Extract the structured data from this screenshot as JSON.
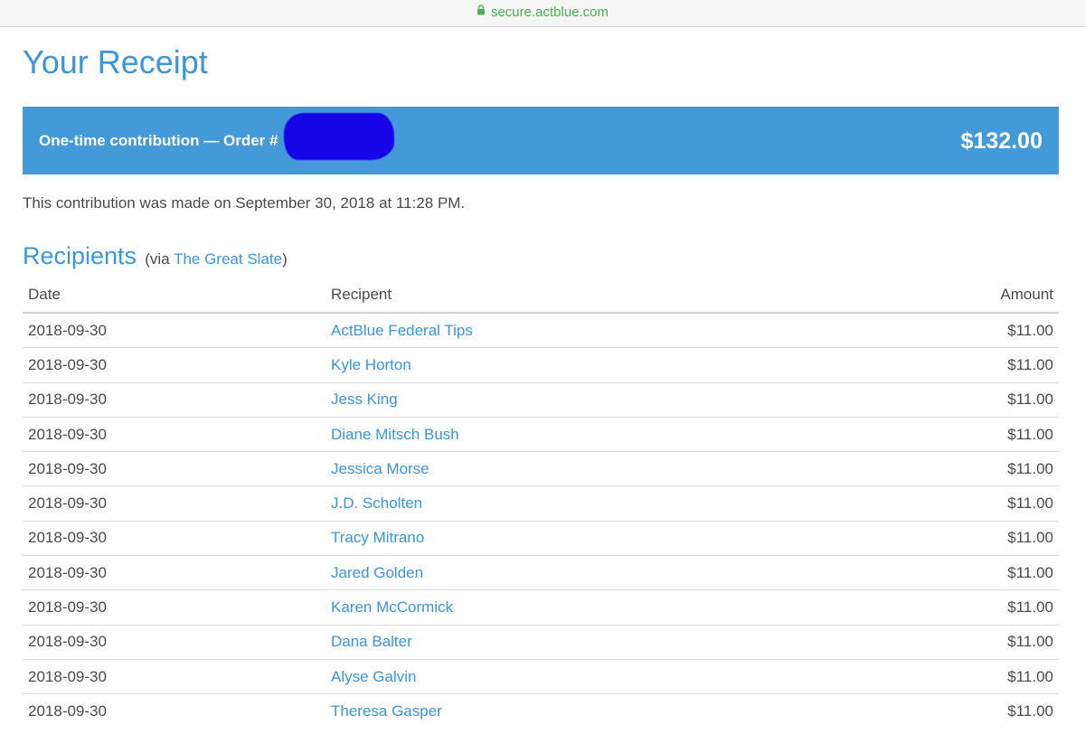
{
  "browser": {
    "url": "secure.actblue.com"
  },
  "page": {
    "title": "Your Receipt"
  },
  "banner": {
    "label": "One-time contribution — Order #",
    "amount": "$132.00"
  },
  "made_on": "This contribution was made on September 30, 2018 at 11:28 PM.",
  "recipients": {
    "title": "Recipients",
    "via_prefix": "(via ",
    "via_link": "The Great Slate",
    "via_suffix": ")",
    "columns": {
      "date": "Date",
      "recipient": "Recipent",
      "amount": "Amount"
    },
    "rows": [
      {
        "date": "2018-09-30",
        "recipient": "ActBlue Federal Tips",
        "amount": "$11.00"
      },
      {
        "date": "2018-09-30",
        "recipient": "Kyle Horton",
        "amount": "$11.00"
      },
      {
        "date": "2018-09-30",
        "recipient": "Jess King",
        "amount": "$11.00"
      },
      {
        "date": "2018-09-30",
        "recipient": "Diane Mitsch Bush",
        "amount": "$11.00"
      },
      {
        "date": "2018-09-30",
        "recipient": "Jessica Morse",
        "amount": "$11.00"
      },
      {
        "date": "2018-09-30",
        "recipient": "J.D. Scholten",
        "amount": "$11.00"
      },
      {
        "date": "2018-09-30",
        "recipient": "Tracy Mitrano",
        "amount": "$11.00"
      },
      {
        "date": "2018-09-30",
        "recipient": "Jared Golden",
        "amount": "$11.00"
      },
      {
        "date": "2018-09-30",
        "recipient": "Karen McCormick",
        "amount": "$11.00"
      },
      {
        "date": "2018-09-30",
        "recipient": "Dana Balter",
        "amount": "$11.00"
      },
      {
        "date": "2018-09-30",
        "recipient": "Alyse Galvin",
        "amount": "$11.00"
      },
      {
        "date": "2018-09-30",
        "recipient": "Theresa Gasper",
        "amount": "$11.00"
      }
    ]
  },
  "icons": {
    "lock": "lock-icon"
  },
  "colors": {
    "accent": "#3a96d8",
    "banner_bg": "#4499d9",
    "redaction": "#1505e8",
    "secure_green": "#4caf50"
  }
}
